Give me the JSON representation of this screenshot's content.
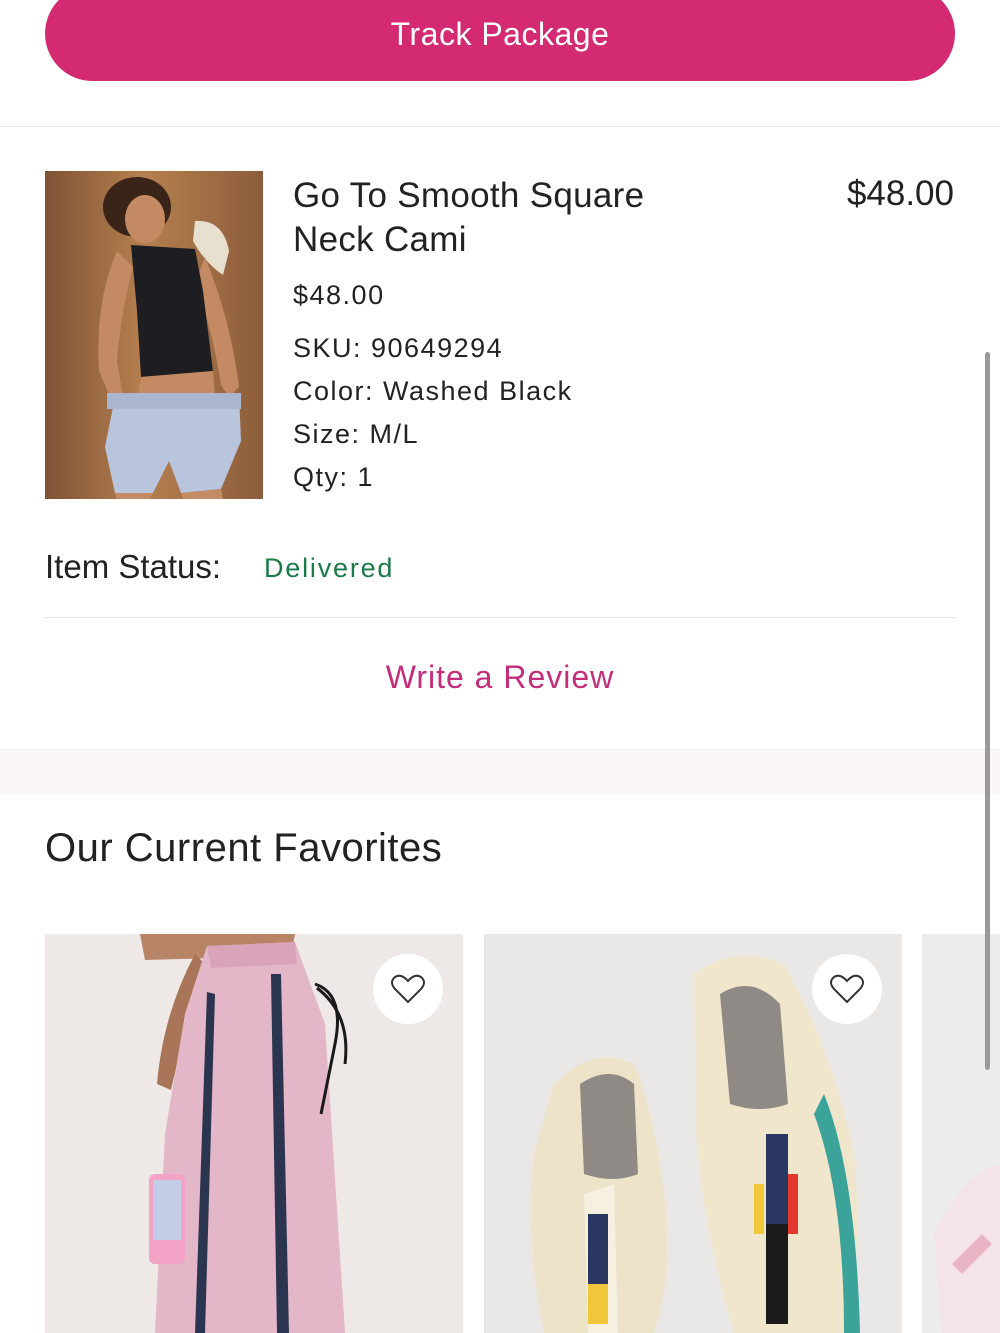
{
  "order": {
    "track_button_label": "Track Package"
  },
  "item": {
    "name": "Go To Smooth Square Neck Cami",
    "price": "$48.00",
    "line_total": "$48.00",
    "sku": "SKU: 90649294",
    "color": "Color: Washed Black",
    "size": "Size: M/L",
    "qty": "Qty: 1",
    "status_label": "Item Status:",
    "status_value": "Delivered",
    "review_link": "Write a Review"
  },
  "favorites": {
    "title": "Our Current Favorites",
    "cards": [
      {
        "id": "pink-track-pants",
        "icon": "heart-icon"
      },
      {
        "id": "cream-sneakers",
        "icon": "heart-icon"
      },
      {
        "id": "partial-card",
        "icon": ""
      }
    ]
  },
  "colors": {
    "accent": "#d42a72",
    "link": "#c42d7a",
    "status_ok": "#1a7a48"
  }
}
